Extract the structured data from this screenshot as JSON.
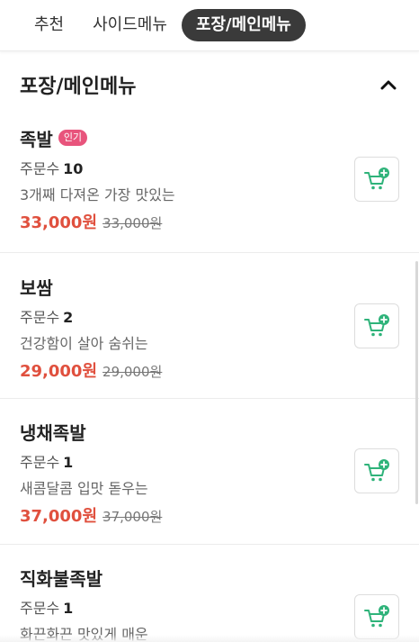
{
  "tabs": [
    {
      "label": "추천",
      "active": false
    },
    {
      "label": "사이드메뉴",
      "active": false
    },
    {
      "label": "포장/메인메뉴",
      "active": true
    }
  ],
  "section": {
    "title": "포장/메인메뉴",
    "collapse_icon": "chevron-up-icon"
  },
  "orders_label": "주문수",
  "cart_icon": "cart-plus-icon",
  "accent_color": "#e0503e",
  "badge_color": "#e8547c",
  "cart_icon_color": "#2fb37a",
  "items": [
    {
      "name": "족발",
      "badge": "인기",
      "order_count": "10",
      "description": "3개째 다져온 가장 맛있는",
      "price": "33,000원",
      "original_price": "33,000원"
    },
    {
      "name": "보쌈",
      "badge": "",
      "order_count": "2",
      "description": "건강함이 살아 숨쉬는",
      "price": "29,000원",
      "original_price": "29,000원"
    },
    {
      "name": "냉채족발",
      "badge": "",
      "order_count": "1",
      "description": "새콤달콤 입맛 돋우는",
      "price": "37,000원",
      "original_price": "37,000원"
    },
    {
      "name": "직화불족발",
      "badge": "",
      "order_count": "1",
      "description": "화끈화끈 맛있게 매운",
      "price": "",
      "original_price": ""
    }
  ]
}
